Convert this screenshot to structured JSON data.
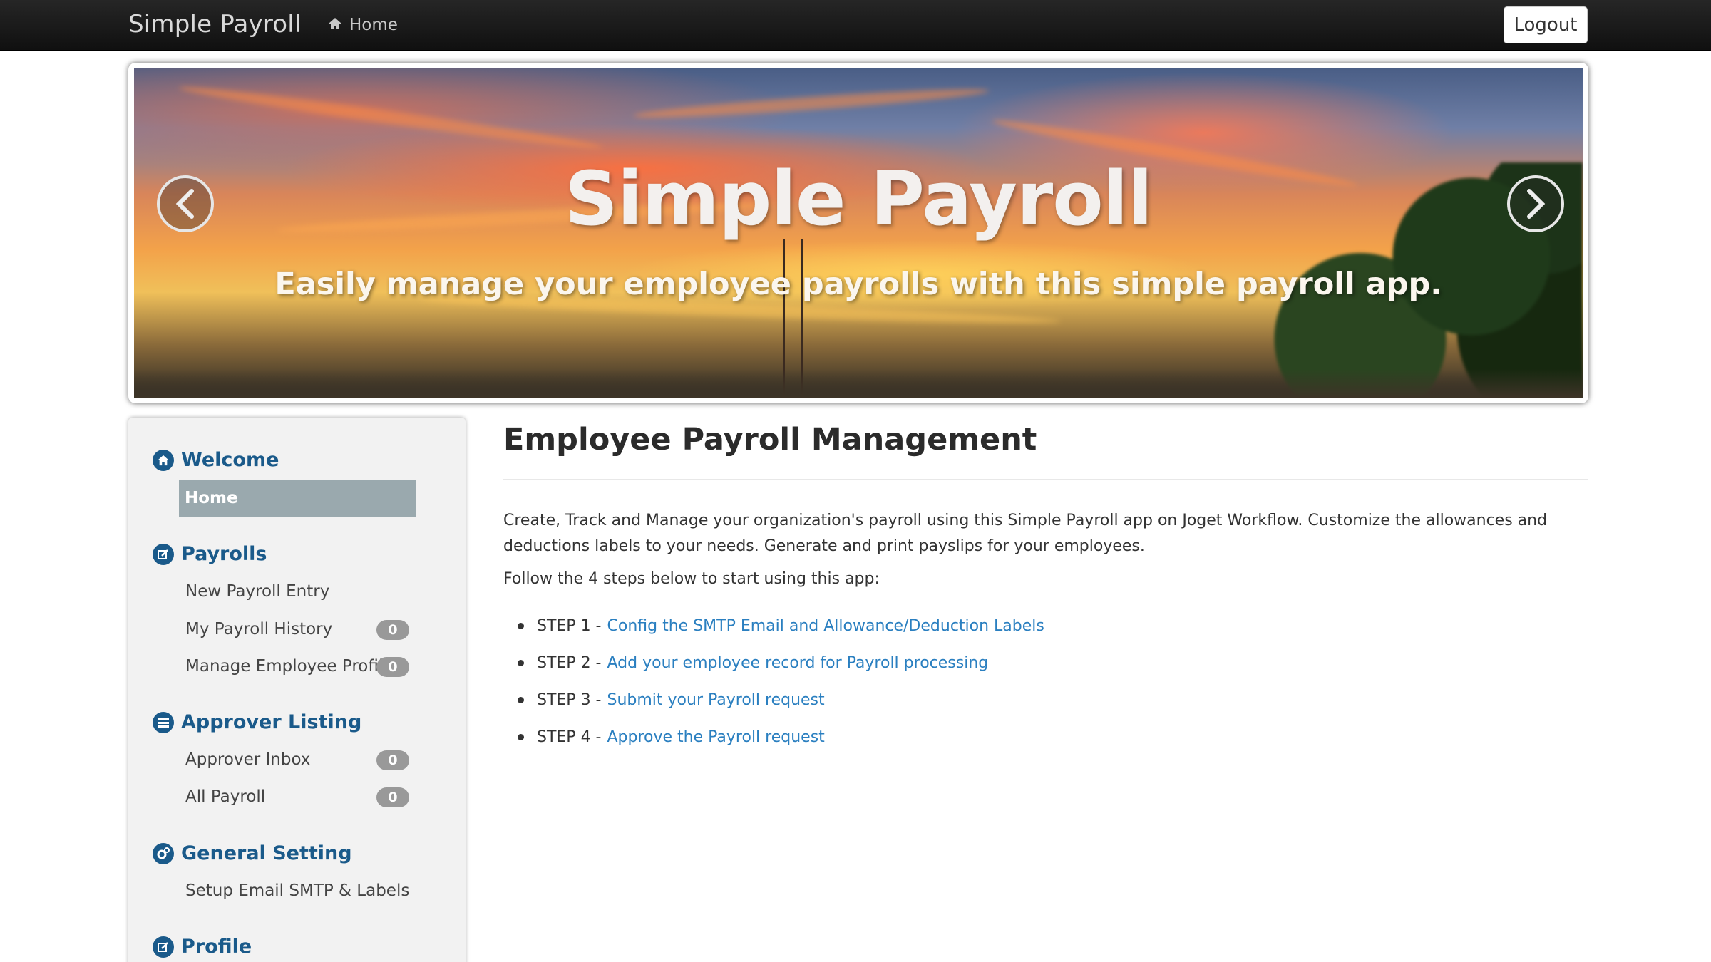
{
  "navbar": {
    "brand": "Simple Payroll",
    "home_label": "Home",
    "logout_label": "Logout"
  },
  "carousel": {
    "title": "Simple Payroll",
    "subtitle": "Easily manage your employee payrolls with this simple payroll app."
  },
  "sidebar": {
    "categories": [
      {
        "label": "Welcome",
        "icon": "home-icon",
        "items": [
          {
            "label": "Home",
            "active": true
          }
        ]
      },
      {
        "label": "Payrolls",
        "icon": "edit-icon",
        "items": [
          {
            "label": "New Payroll Entry"
          },
          {
            "label": "My Payroll History",
            "badge": "0"
          },
          {
            "label": "Manage Employee Profile",
            "badge": "0"
          }
        ]
      },
      {
        "label": "Approver Listing",
        "icon": "list-icon",
        "items": [
          {
            "label": "Approver Inbox",
            "badge": "0"
          },
          {
            "label": "All Payroll",
            "badge": "0"
          }
        ]
      },
      {
        "label": "General Setting",
        "icon": "gears-icon",
        "items": [
          {
            "label": "Setup Email SMTP & Labels"
          }
        ]
      },
      {
        "label": "Profile",
        "icon": "edit-icon",
        "items": []
      }
    ]
  },
  "main": {
    "title": "Employee Payroll Management",
    "intro": "Create, Track and Manage your organization's payroll using this Simple Payroll app on Joget Workflow. Customize the allowances and deductions labels to your needs. Generate and print payslips for your employees.",
    "follow": "Follow the 4 steps below to start using this app:",
    "steps": [
      {
        "prefix": "STEP 1 -",
        "link": "Config the SMTP Email and Allowance/Deduction Labels"
      },
      {
        "prefix": "STEP 2 -",
        "link": "Add your employee record for Payroll processing"
      },
      {
        "prefix": "STEP 3 -",
        "link": "Submit your Payroll request"
      },
      {
        "prefix": "STEP 4 -",
        "link": "Approve the Payroll request"
      }
    ]
  },
  "colors": {
    "navbar": "#1a1a1a",
    "sidebar_heading": "#1a5a8a",
    "active_item": "#9aa9ae",
    "badge": "#999999",
    "link": "#2a7fc0"
  }
}
